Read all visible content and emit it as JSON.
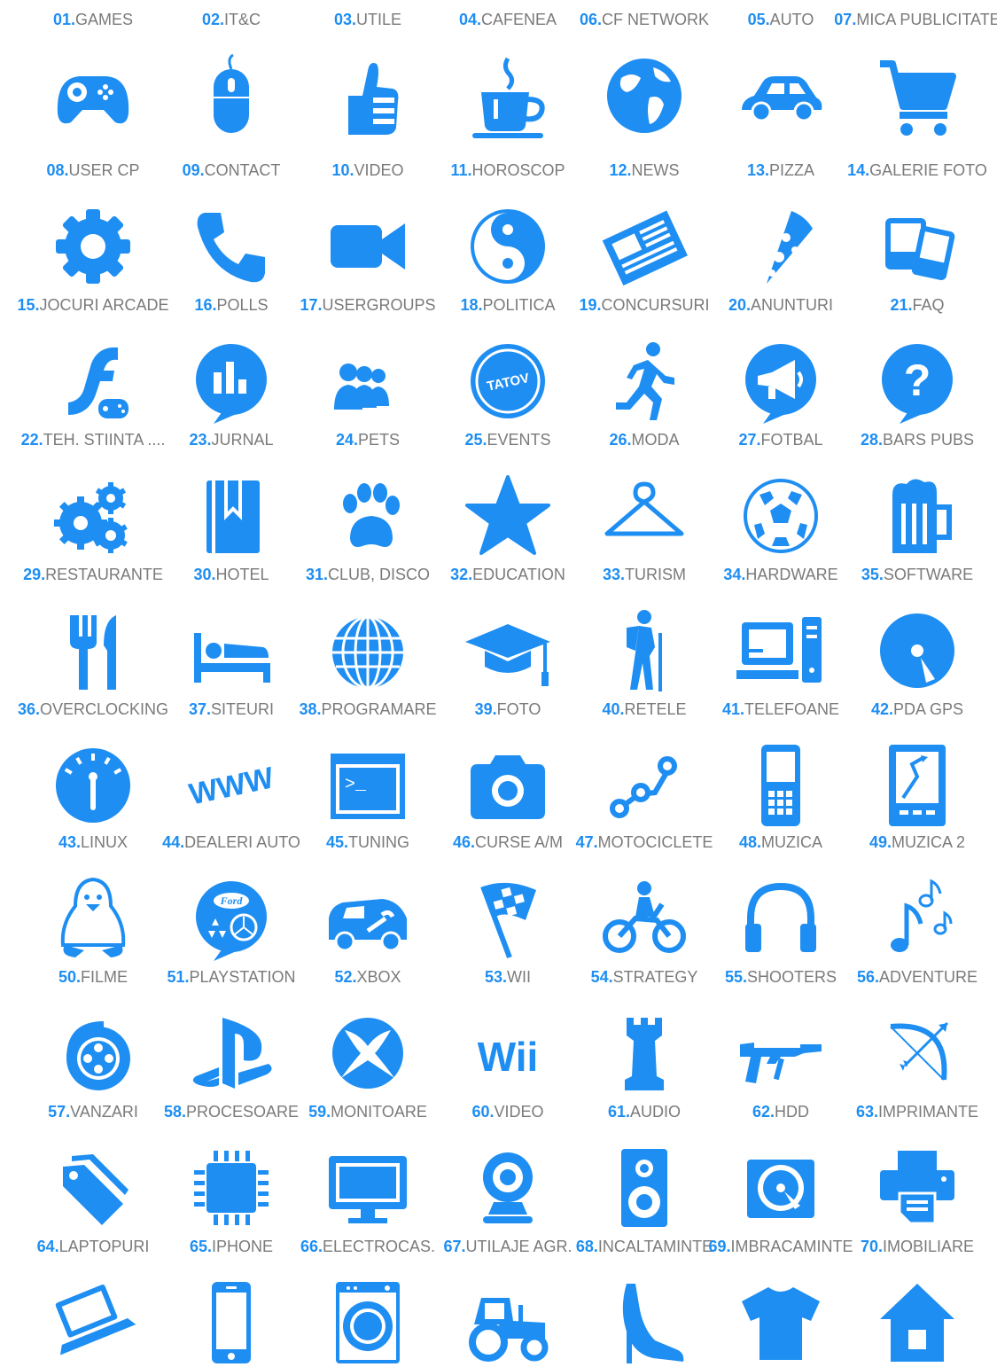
{
  "accent": "#1e8ef2",
  "label_color": "#7a7a7a",
  "items": [
    {
      "num": "01.",
      "name": "GAMES",
      "icon": "gamepad-icon"
    },
    {
      "num": "02.",
      "name": "IT&C",
      "icon": "mouse-icon"
    },
    {
      "num": "03.",
      "name": "UTILE",
      "icon": "thumbs-up-icon"
    },
    {
      "num": "04.",
      "name": "CAFENEA",
      "icon": "coffee-cup-icon"
    },
    {
      "num": "06.",
      "name": "CF NETWORK",
      "icon": "globe-icon"
    },
    {
      "num": "05.",
      "name": "AUTO",
      "icon": "car-icon"
    },
    {
      "num": "07.",
      "name": "MICA PUBLICITATE",
      "icon": "shopping-cart-icon"
    },
    {
      "num": "08.",
      "name": "USER CP",
      "icon": "gear-icon"
    },
    {
      "num": "09.",
      "name": "CONTACT",
      "icon": "phone-icon"
    },
    {
      "num": "10.",
      "name": "VIDEO",
      "icon": "video-camera-icon"
    },
    {
      "num": "11.",
      "name": "HOROSCOP",
      "icon": "yin-yang-icon"
    },
    {
      "num": "12.",
      "name": "NEWS",
      "icon": "newspaper-icon"
    },
    {
      "num": "13.",
      "name": "PIZZA",
      "icon": "pizza-icon"
    },
    {
      "num": "14.",
      "name": "GALERIE FOTO",
      "icon": "photo-gallery-icon"
    },
    {
      "num": "15.",
      "name": "JOCURI ARCADE",
      "icon": "flash-gamepad-icon"
    },
    {
      "num": "16.",
      "name": "POLLS",
      "icon": "poll-chart-bubble-icon"
    },
    {
      "num": "17.",
      "name": "USERGROUPS",
      "icon": "user-group-icon"
    },
    {
      "num": "18.",
      "name": "POLITICA",
      "icon": "tatov-badge-icon",
      "badge": "TATOV"
    },
    {
      "num": "19.",
      "name": "CONCURSURI",
      "icon": "runner-icon"
    },
    {
      "num": "20.",
      "name": "ANUNTURI",
      "icon": "megaphone-bubble-icon"
    },
    {
      "num": "21.",
      "name": "FAQ",
      "icon": "question-bubble-icon"
    },
    {
      "num": "22.",
      "name": "TEH. STIINTA ....",
      "icon": "gears-icon"
    },
    {
      "num": "23.",
      "name": "JURNAL",
      "icon": "journal-bookmark-icon"
    },
    {
      "num": "24.",
      "name": "PETS",
      "icon": "paw-icon"
    },
    {
      "num": "25.",
      "name": "EVENTS",
      "icon": "star-icon"
    },
    {
      "num": "26.",
      "name": "MODA",
      "icon": "hanger-icon"
    },
    {
      "num": "27.",
      "name": "FOTBAL",
      "icon": "soccer-ball-icon"
    },
    {
      "num": "28.",
      "name": "BARS PUBS",
      "icon": "beer-mug-icon"
    },
    {
      "num": "29.",
      "name": "RESTAURANTE",
      "icon": "fork-knife-icon"
    },
    {
      "num": "30.",
      "name": "HOTEL",
      "icon": "bed-icon"
    },
    {
      "num": "31.",
      "name": "CLUB, DISCO",
      "icon": "disco-ball-icon"
    },
    {
      "num": "32.",
      "name": "EDUCATION",
      "icon": "graduation-cap-icon"
    },
    {
      "num": "33.",
      "name": "TURISM",
      "icon": "hiker-icon"
    },
    {
      "num": "34.",
      "name": "HARDWARE",
      "icon": "desktop-computer-icon"
    },
    {
      "num": "35.",
      "name": "SOFTWARE",
      "icon": "disc-icon"
    },
    {
      "num": "36.",
      "name": "OVERCLOCKING",
      "icon": "speedometer-icon"
    },
    {
      "num": "37.",
      "name": "SITEURI",
      "icon": "www-icon",
      "badge": "WWW"
    },
    {
      "num": "38.",
      "name": "PROGRAMARE",
      "icon": "terminal-window-icon",
      "badge": ">_"
    },
    {
      "num": "39.",
      "name": "FOTO",
      "icon": "camera-icon"
    },
    {
      "num": "40.",
      "name": "RETELE",
      "icon": "network-nodes-icon"
    },
    {
      "num": "41.",
      "name": "TELEFOANE",
      "icon": "mobile-phone-icon"
    },
    {
      "num": "42.",
      "name": "PDA GPS",
      "icon": "gps-device-icon"
    },
    {
      "num": "43.",
      "name": "LINUX",
      "icon": "tux-penguin-icon"
    },
    {
      "num": "44.",
      "name": "DEALERI AUTO",
      "icon": "car-brands-bubble-icon",
      "badge": "Ford"
    },
    {
      "num": "45.",
      "name": "TUNING",
      "icon": "car-wrench-icon"
    },
    {
      "num": "46.",
      "name": "CURSE A/M",
      "icon": "checkered-flag-icon"
    },
    {
      "num": "47.",
      "name": "MOTOCICLETE",
      "icon": "motorcycle-icon"
    },
    {
      "num": "48.",
      "name": "MUZICA",
      "icon": "headphones-icon"
    },
    {
      "num": "49.",
      "name": "MUZICA 2",
      "icon": "music-notes-icon"
    },
    {
      "num": "50.",
      "name": "FILME",
      "icon": "film-reel-icon"
    },
    {
      "num": "51.",
      "name": "PLAYSTATION",
      "icon": "playstation-icon"
    },
    {
      "num": "52.",
      "name": "XBOX",
      "icon": "xbox-icon"
    },
    {
      "num": "53.",
      "name": "WII",
      "icon": "wii-icon",
      "badge": "Wii"
    },
    {
      "num": "54.",
      "name": "STRATEGY",
      "icon": "chess-rook-icon"
    },
    {
      "num": "55.",
      "name": "SHOOTERS",
      "icon": "submachine-gun-icon"
    },
    {
      "num": "56.",
      "name": "ADVENTURE",
      "icon": "bow-arrow-icon"
    },
    {
      "num": "57.",
      "name": "VANZARI",
      "icon": "price-tags-icon"
    },
    {
      "num": "58.",
      "name": "PROCESOARE",
      "icon": "cpu-chip-icon"
    },
    {
      "num": "59.",
      "name": "MONITOARE",
      "icon": "monitor-icon"
    },
    {
      "num": "60.",
      "name": "VIDEO",
      "icon": "webcam-icon"
    },
    {
      "num": "61.",
      "name": "AUDIO",
      "icon": "speaker-icon"
    },
    {
      "num": "62.",
      "name": "HDD",
      "icon": "hard-drive-icon"
    },
    {
      "num": "63.",
      "name": "IMPRIMANTE",
      "icon": "printer-icon"
    },
    {
      "num": "64.",
      "name": "LAPTOPURI",
      "icon": "laptop-icon"
    },
    {
      "num": "65.",
      "name": "IPHONE",
      "icon": "smartphone-icon"
    },
    {
      "num": "66.",
      "name": "ELECTROCAS.",
      "icon": "washing-machine-icon"
    },
    {
      "num": "67.",
      "name": "UTILAJE AGR.",
      "icon": "tractor-icon"
    },
    {
      "num": "68.",
      "name": "INCALTAMINTE",
      "icon": "high-heel-icon"
    },
    {
      "num": "69.",
      "name": "IMBRACAMINTE",
      "icon": "t-shirt-icon"
    },
    {
      "num": "70.",
      "name": "IMOBILIARE",
      "icon": "house-icon"
    }
  ]
}
